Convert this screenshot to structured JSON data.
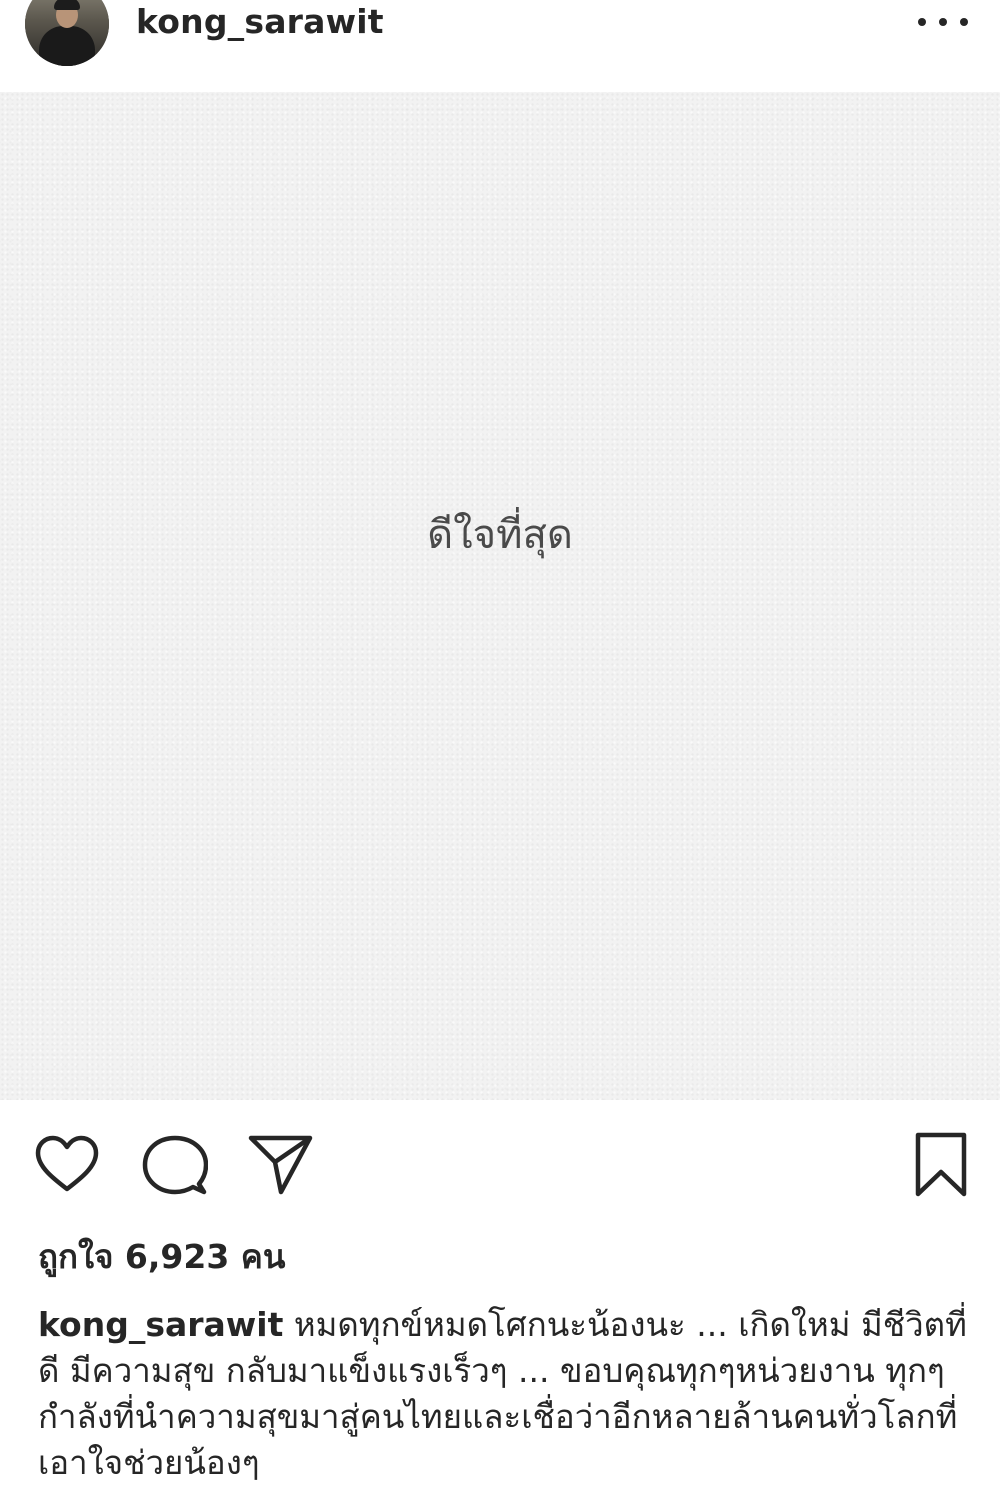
{
  "post": {
    "username": "kong_sarawit",
    "image_text": "ดีใจที่สุด",
    "likes_text": "ถูกใจ 6,923 คน",
    "caption_user": "kong_sarawit",
    "caption_text": "หมดทุกข์หมดโศกนะน้องนะ ... เกิดใหม่ มีชีวิตที่ดี มีความสุข กลับมาแข็งแรงเร็วๆ ... ขอบคุณทุกๆหน่วยงาน ทุกๆกำลังที่นำความสุขมาสู่คนไทยและเชื่อว่าอีกหลายล้านคนทั่วโลกที่เอาใจช่วยน้องๆ"
  },
  "icons": {
    "more": "more-options-icon",
    "like": "heart-icon",
    "comment": "comment-icon",
    "share": "send-icon",
    "save": "bookmark-icon"
  }
}
